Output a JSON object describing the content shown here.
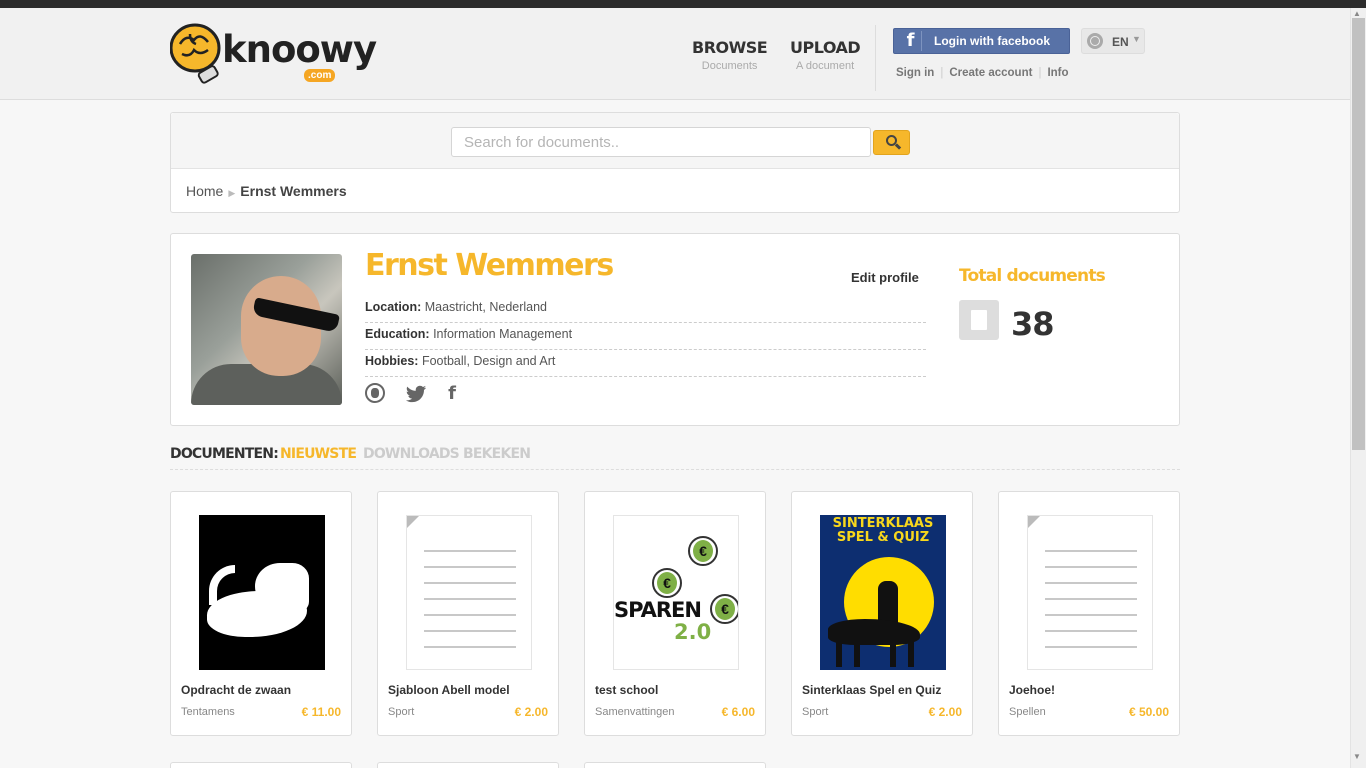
{
  "header": {
    "logo_word": "knoowy",
    "logo_com": ".com",
    "nav": [
      {
        "main": "BROWSE",
        "sub": "Documents"
      },
      {
        "main": "UPLOAD",
        "sub": "A document"
      }
    ],
    "facebook_label": "Login with facebook",
    "language": "EN",
    "links": {
      "sign_in": "Sign in",
      "create_account": "Create account",
      "info": "Info"
    }
  },
  "search": {
    "placeholder": "Search for documents.."
  },
  "breadcrumb": {
    "home": "Home",
    "current": "Ernst Wemmers"
  },
  "profile": {
    "name": "Ernst Wemmers",
    "edit_label": "Edit profile",
    "fields": [
      {
        "label": "Location:",
        "value": "Maastricht, Nederland"
      },
      {
        "label": "Education:",
        "value": "Information Management"
      },
      {
        "label": "Hobbies:",
        "value": "Football, Design and Art"
      }
    ],
    "total_label": "Total documents",
    "total_count": "38"
  },
  "tabs": {
    "label": "DOCUMENTEN:",
    "items": [
      "NIEUWSTE",
      "DOWNLOADS",
      "BEKEKEN"
    ]
  },
  "documents": [
    {
      "title": "Opdracht de zwaan",
      "category": "Tentamens",
      "price": "€ 11.00",
      "thumb": "swan"
    },
    {
      "title": "Sjabloon Abell model",
      "category": "Sport",
      "price": "€ 2.00",
      "thumb": "blank"
    },
    {
      "title": "test school",
      "category": "Samenvattingen",
      "price": "€ 6.00",
      "thumb": "sparen"
    },
    {
      "title": "Sinterklaas Spel en Quiz",
      "category": "Sport",
      "price": "€ 2.00",
      "thumb": "sinterklaas"
    },
    {
      "title": "Joehoe!",
      "category": "Spellen",
      "price": "€ 50.00",
      "thumb": "blank"
    }
  ],
  "thumb_text": {
    "sparen_word": "SPAREN",
    "sparen_version": "2.0",
    "sinterklaas_line1": "SINTERKLAAS",
    "sinterklaas_line2": "SPEL & QUIZ"
  },
  "colors": {
    "accent": "#f6b72b",
    "facebook": "#5872a7",
    "topbar": "#2c2c2c"
  },
  "icons": [
    "brain-bulb-logo-icon",
    "facebook-icon",
    "globe-icon",
    "search-icon",
    "twitter-icon",
    "document-icon"
  ]
}
